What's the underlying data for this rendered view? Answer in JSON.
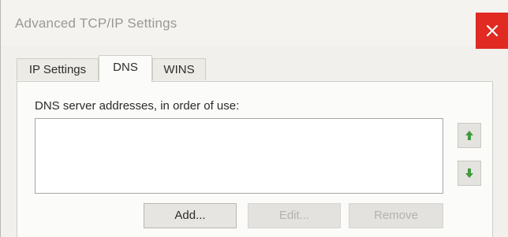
{
  "window": {
    "title": "Advanced TCP/IP Settings",
    "close_label": "×"
  },
  "tabs": [
    {
      "label": "IP Settings",
      "selected": false
    },
    {
      "label": "DNS",
      "selected": true
    },
    {
      "label": "WINS",
      "selected": false
    }
  ],
  "dns": {
    "list_label": "DNS server addresses, in order of use:",
    "addresses": [],
    "buttons": {
      "add": "Add...",
      "edit": "Edit...",
      "remove": "Remove"
    },
    "move_up_icon": "arrow-up-icon",
    "move_down_icon": "arrow-down-icon"
  },
  "colors": {
    "close_button": "#e02a22",
    "arrow_green": "#3f9a3c"
  }
}
